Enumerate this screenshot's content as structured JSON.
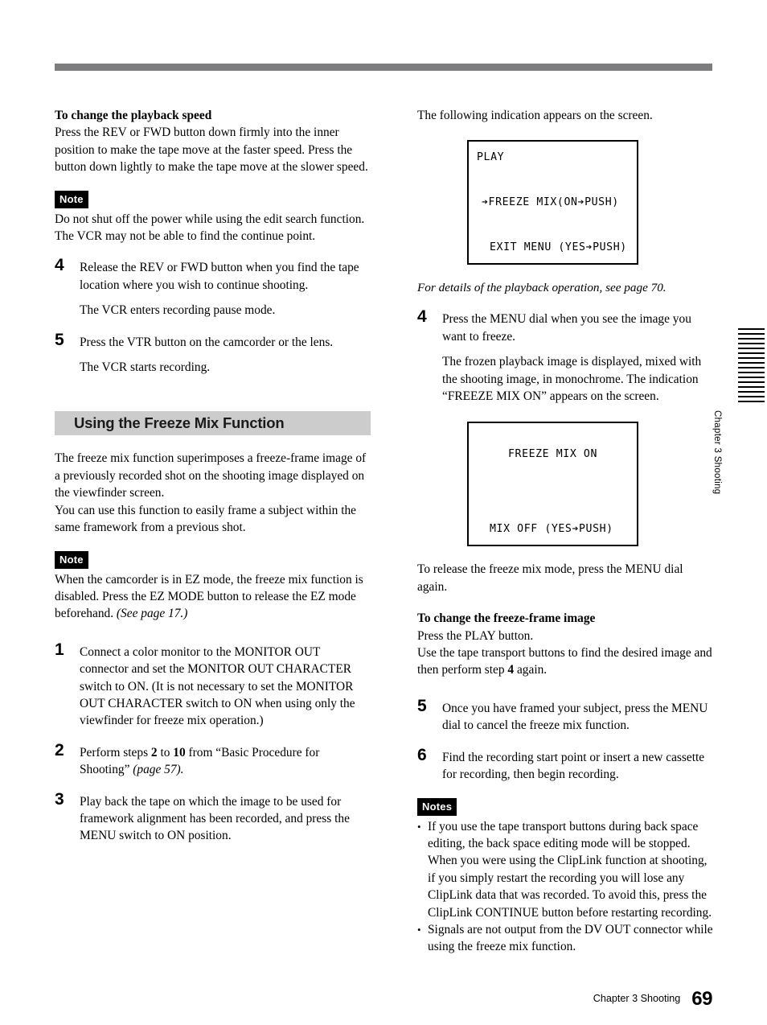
{
  "page": {
    "number": "69",
    "footer_chapter": "Chapter 3  Shooting",
    "edge_tab": "Chapter 3  Shooting"
  },
  "left_column": {
    "subhead_playback_speed": "To change the playback speed",
    "para_playback_speed": "Press the REV or FWD button down firmly into the inner position to make the tape move at the faster speed.  Press the button down lightly to make the tape move at the slower speed.",
    "note_badge": "Note",
    "note_text": "Do not shut off the power while using the edit search function. The VCR may not be able to find the continue point.",
    "step4": {
      "num": "4",
      "text": "Release the REV or FWD button when you find the tape location where you wish to continue shooting.",
      "result": "The VCR enters recording pause mode."
    },
    "step5": {
      "num": "5",
      "text": "Press the VTR button on the camcorder or the lens.",
      "result": "The VCR starts recording."
    },
    "section_heading": "Using the Freeze Mix Function",
    "intro_para1": "The freeze mix function superimposes a freeze-frame image of a previously recorded shot on the shooting image displayed on the viewfinder screen.",
    "intro_para2": "You can use this function to easily frame a subject within the same framework from a previous shot.",
    "note2_badge": "Note",
    "note2_text_a": "When the camcorder is in EZ mode, the freeze mix function is disabled.  Press the EZ MODE button to release the EZ mode beforehand. ",
    "note2_text_ital": "(See page 17.)",
    "step1": {
      "num": "1",
      "text": "Connect a color monitor to the MONITOR OUT connector and set the MONITOR OUT CHARACTER switch to ON.  (It is not necessary to set the MONITOR OUT CHARACTER switch to ON when using only the viewfinder for freeze mix operation.)"
    },
    "step2": {
      "num": "2",
      "text_a": "Perform steps ",
      "bold_b": "2",
      "text_c": " to ",
      "bold_d": "10",
      "text_e": " from “Basic Procedure for Shooting” ",
      "ital_f": "(page 57)."
    },
    "step3": {
      "num": "3",
      "text": "Play back the tape on which the image to be used for framework alignment has been recorded, and press the MENU switch to ON position."
    }
  },
  "right_column": {
    "lead_text": "The following indication appears on the screen.",
    "screen1": {
      "line1": "PLAY",
      "line2": "➔FREEZE MIX(ON➔PUSH)",
      "line3": "EXIT MENU (YES➔PUSH)"
    },
    "caption1": "For details of the playback operation, see page 70.",
    "step4": {
      "num": "4",
      "text": "Press the MENU dial when you see the image you want to freeze.",
      "result": "The frozen playback image is displayed, mixed with the shooting image, in monochrome.  The indication “FREEZE MIX ON” appears on the screen."
    },
    "screen2": {
      "line1": "FREEZE MIX ON",
      "line2": "MIX OFF (YES➔PUSH)"
    },
    "after_screen2": "To release the freeze mix mode, press the MENU dial again.",
    "subhead_change_frame": "To change the freeze-frame image",
    "change_frame_l1": "Press the PLAY button.",
    "change_frame_l2a": "Use the tape transport buttons to find the desired image and then perform step ",
    "change_frame_bold": "4",
    "change_frame_l2b": " again.",
    "step5": {
      "num": "5",
      "text": "Once you have framed your subject, press the MENU dial to cancel the freeze mix function."
    },
    "step6": {
      "num": "6",
      "text": "Find the recording start point or insert a new cassette for recording, then begin recording."
    },
    "notes_badge": "Notes",
    "notes": [
      "If you use the tape transport buttons during back space editing, the back space editing mode will be stopped.  When you were using the ClipLink function at shooting, if you simply restart the recording you will lose any ClipLink data that was recorded.  To avoid this, press the ClipLink CONTINUE button before restarting recording.",
      "Signals are not output from the DV OUT connector while using the freeze mix function."
    ]
  },
  "colors": {
    "top_rule": "#7d7d80",
    "section_band": "#cccccc",
    "badge_bg": "#000000"
  }
}
